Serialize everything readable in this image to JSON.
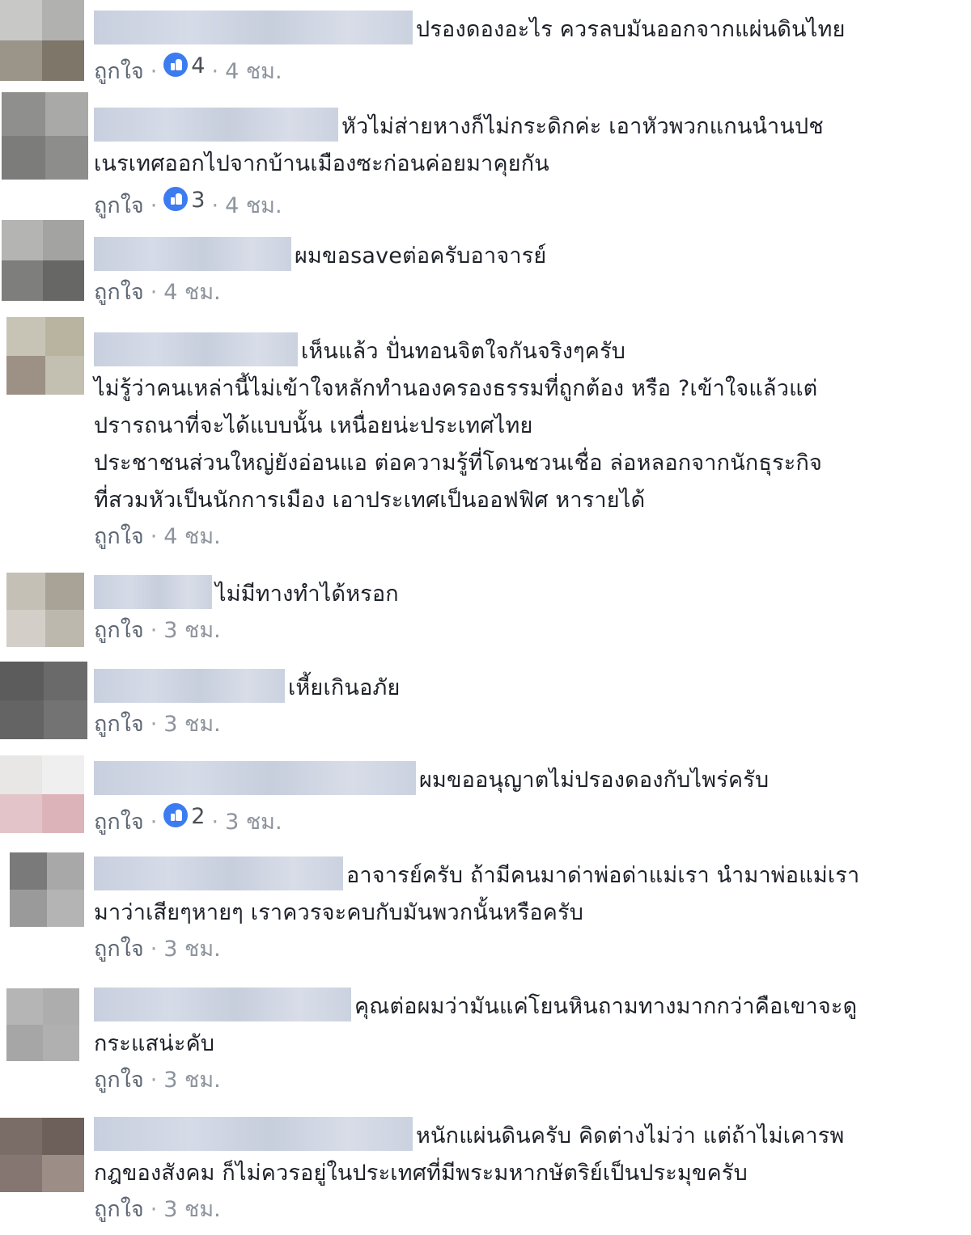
{
  "comments": [
    {
      "text": "ปรองดองอะไร ควรลบมันออกจากแผ่นดินไทย",
      "like_label": "ถูกใจ",
      "reactions": "4",
      "time": "4 ชม."
    },
    {
      "text": "หัวไม่ส่ายหางก็ไม่กระดิกค่ะ เอาหัวพวกแกนนำนปช",
      "text2": "เนรเทศออกไปจากบ้านเมืองซะก่อนค่อยมาคุยกัน",
      "like_label": "ถูกใจ",
      "reactions": "3",
      "time": "4 ชม."
    },
    {
      "text": "ผมขอsaveต่อครับอาจารย์",
      "like_label": "ถูกใจ",
      "time": "4 ชม."
    },
    {
      "text": "เห็นแล้ว ปั่นทอนจิตใจกันจริงๆครับ",
      "text2": "ไม่รู้ว่าคนเหล่านี้ไม่เข้าใจหลักทำนองครองธรรมที่ถูกต้อง หรือ ?เข้าใจแล้วแต่",
      "text3": "ปรารถนาที่จะได้แบบนั้น เหนื่อยน่ะประเทศไทย",
      "text4": "ประชาชนส่วนใหญ่ยังอ่อนแอ ต่อความรู้ที่โดนชวนเชื่อ ล่อหลอกจากนักธุระกิจ",
      "text5": "ที่สวมหัวเป็นนักการเมือง เอาประเทศเป็นออฟฟิศ หารายได้",
      "like_label": "ถูกใจ",
      "time": "4 ชม."
    },
    {
      "text": "ไม่มีทางทำได้หรอก",
      "like_label": "ถูกใจ",
      "time": "3 ชม."
    },
    {
      "text": "เหี้ยเกินอภัย",
      "like_label": "ถูกใจ",
      "time": "3 ชม."
    },
    {
      "text": "ผมขออนุญาตไม่ปรองดองกับไพร่ครับ",
      "like_label": "ถูกใจ",
      "reactions": "2",
      "time": "3 ชม."
    },
    {
      "text": "อาจารย์ครับ ถ้ามีคนมาด่าพ่อด่าแม่เรา นำมาพ่อแม่เรา",
      "text2": "มาว่าเสียๆหายๆ เราควรจะคบกับมันพวกนั้นหรือครับ",
      "like_label": "ถูกใจ",
      "time": "3 ชม."
    },
    {
      "text": "คุณต่อผมว่ามันแค่โยนหินถามทางมากกว่าคือเขาจะดู",
      "text2": "กระแสน่ะคับ",
      "like_label": "ถูกใจ",
      "time": "3 ชม."
    },
    {
      "text": "หนักแผ่นดินครับ คิดต่างไม่ว่า แต่ถ้าไม่เคารพ",
      "text2": "กฎของสังคม ก็ไม่ควรอยู่ในประเทศที่มีพระมหากษัตริย์เป็นประมุขครับ",
      "like_label": "ถูกใจ",
      "time": "3 ชม."
    }
  ],
  "icons": {
    "reaction": "like-reaction-icon"
  },
  "colors": {
    "like_reaction": "#3c7bf0",
    "meta_text": "#8d949e",
    "name_blur": "#cfd5e2"
  }
}
